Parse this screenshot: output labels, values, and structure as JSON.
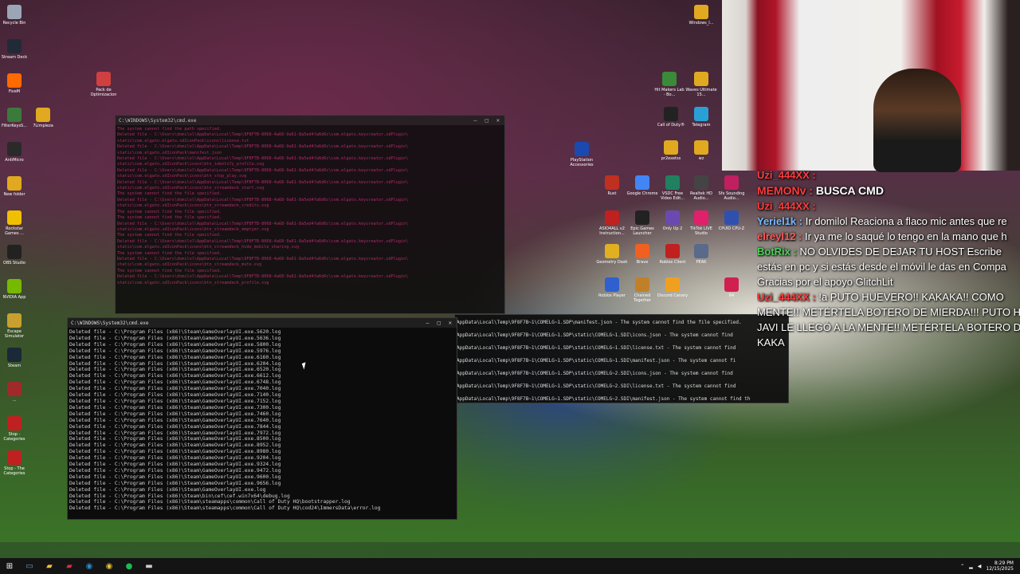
{
  "desktop": {
    "left_icons": [
      {
        "label": "Recycle Bin",
        "color": "#9aa6b5"
      },
      {
        "label": "Stream Deck",
        "color": "#222a38"
      },
      {
        "label": "FiveM",
        "color": "#ff6a00"
      },
      {
        "label": "FilterKeysS...",
        "color": "#3a7a3a"
      },
      {
        "label": "AntiMicro",
        "color": "#2a2a2a"
      },
      {
        "label": "New folder",
        "color": "#e0a920"
      },
      {
        "label": "Rockstar Games ...",
        "color": "#f0c000"
      },
      {
        "label": "OBS Studio",
        "color": "#222"
      },
      {
        "label": "NVIDIA App",
        "color": "#76b900"
      },
      {
        "label": "Escape Simulator",
        "color": "#c8a030"
      },
      {
        "label": "Steam",
        "color": "#1b2838"
      },
      {
        "label": "...",
        "color": "#a02a2a"
      },
      {
        "label": "Stop - Categories",
        "color": "#c02020"
      },
      {
        "label": "Stop - The Categories",
        "color": "#c02020"
      }
    ],
    "col2_icons": [
      {
        "label": "Pack de Optimizacion",
        "color": "#d04040"
      },
      {
        "label": "7Limpieza",
        "color": "#e0a920"
      }
    ],
    "right_icons": [
      {
        "label": "Windows_I...",
        "color": "#e0a920"
      },
      {
        "label": "Hit Makers Lab - Bo...",
        "color": "#3a8a3a"
      },
      {
        "label": "Waves Ultimate 15...",
        "color": "#e0a920"
      },
      {
        "label": "Call of Duty®",
        "color": "#222"
      },
      {
        "label": "Telegram",
        "color": "#2a9fd6"
      },
      {
        "label": "PlayStation Accessories",
        "color": "#1a4ab0"
      },
      {
        "label": "pr2exetss",
        "color": "#e0a920"
      },
      {
        "label": "wz",
        "color": "#e0a920"
      },
      {
        "label": "Rust",
        "color": "#c03020"
      },
      {
        "label": "Google Chrome",
        "color": "#4285f4"
      },
      {
        "label": "VSDC Free Video Edit...",
        "color": "#208060"
      },
      {
        "label": "Realtek HD Audio...",
        "color": "#444"
      },
      {
        "label": "Sfx Sounding Audio...",
        "color": "#c02060"
      },
      {
        "label": "ASIO4ALL v2 Instruction...",
        "color": "#c02020"
      },
      {
        "label": "Epic Games Launcher",
        "color": "#222"
      },
      {
        "label": "Only Up 2",
        "color": "#6a4ab0"
      },
      {
        "label": "TikTok LIVE Studio",
        "color": "#e0206a"
      },
      {
        "label": "CPUID CPU-Z",
        "color": "#3050b0"
      },
      {
        "label": "Geometry Dash",
        "color": "#e0b020"
      },
      {
        "label": "Brave",
        "color": "#f06020"
      },
      {
        "label": "Roblox Client",
        "color": "#c02020"
      },
      {
        "label": "PEAK",
        "color": "#5a6a8a"
      },
      {
        "label": "Roblox Player",
        "color": "#3060d0"
      },
      {
        "label": "Chained Together",
        "color": "#c0802a"
      },
      {
        "label": "Discord Canary",
        "color": "#f0a020"
      },
      {
        "label": "64",
        "color": "#d02050"
      }
    ]
  },
  "cmd_back": {
    "title": "C:\\WINDOWS\\System32\\cmd.exe",
    "lines": [
      "The system cannot find the path specified.",
      "Deleted file - C:\\Users\\domilol\\AppData\\Local\\Temp\\9F8F7B-8068-4a68-9a61-8a5ed4fa6d6c\\com.elgato.keycreator.sdPlugin\\",
      "static\\com.elgato.elgato.sdIconPack\\icons\\license.txt",
      "Deleted file - C:\\Users\\domilol\\AppData\\Local\\Temp\\9F8F7B-8068-4a68-9a61-8a5ed4fa6d6c\\com.elgato.keycreator.sdPlugin\\",
      "static\\com.elgato.sdIconPack\\manifest.json",
      "Deleted file - C:\\Users\\domilol\\AppData\\Local\\Temp\\9F8F7B-8068-4a68-9a61-8a5ed4fa6d6c\\com.elgato.keycreator.sdPlugin\\",
      "static\\com.elgato.sdIconPack\\icons\\btn_identify_profile.svg",
      "Deleted file - C:\\Users\\domilol\\AppData\\Local\\Temp\\9F8F7B-8068-4a68-9a61-8a5ed4fa6d6c\\com.elgato.keycreator.sdPlugin\\",
      "static\\com.elgato.sdIconPack\\icons\\btn_stop_play.svg",
      "Deleted file - C:\\Users\\domilol\\AppData\\Local\\Temp\\9F8F7B-8068-4a68-9a61-8a5ed4fa6d6c\\com.elgato.keycreator.sdPlugin\\",
      "static\\com.elgato.sdIconPack\\icons\\btn_streamdeck_start.svg",
      "The system cannot find the file specified.",
      "Deleted file - C:\\Users\\domilol\\AppData\\Local\\Temp\\9F8F7B-8068-4a68-9a61-8a5ed4fa6d6c\\com.elgato.keycreator.sdPlugin\\",
      "static\\com.elgato.sdIconPack\\icons\\btn_streamdeck_credits.svg",
      "The system cannot find the file specified.",
      "The system cannot find the file specified.",
      "Deleted file - C:\\Users\\domilol\\AppData\\Local\\Temp\\9F8F7B-8068-4a68-9a61-8a5ed4fa6d6c\\com.elgato.keycreator.sdPlugin\\",
      "static\\com.elgato.sdIconPack\\icons\\btn_streamdeck_emptyer.svg",
      "The system cannot find the file specified.",
      "Deleted file - C:\\Users\\domilol\\AppData\\Local\\Temp\\9F8F7B-8068-4a68-9a61-8a5ed4fa6d6c\\com.elgato.keycreator.sdPlugin\\",
      "static\\com.elgato.sdIconPack\\icons\\btn_streamdeck_hide_mobile_sharing.svg",
      "The system cannot find the file specified.",
      "Deleted file - C:\\Users\\domilol\\AppData\\Local\\Temp\\9F8F7B-8068-4a68-9a61-8a5ed4fa6d6c\\com.elgato.keycreator.sdPlugin\\",
      "static\\com.elgato.sdIconPack\\icons\\btn_streamdeck_mute.svg",
      "The system cannot find the file specified.",
      "Deleted file - C:\\Users\\domilol\\AppData\\Local\\Temp\\9F8F7B-8068-4a68-9a61-8a5ed4fa6d6c\\com.elgato.keycreator.sdPlugin\\",
      "static\\com.elgato.sdIconPack\\icons\\btn_streamdeck_profile.svg"
    ]
  },
  "cmd_main": {
    "title": "C:\\WINDOWS\\System32\\cmd.exe",
    "lines": [
      "Deleted file - C:\\Program Files (x86)\\Steam\\GameOverlayUI.exe.5620.log",
      "Deleted file - C:\\Program Files (x86)\\Steam\\GameOverlayUI.exe.5636.log",
      "Deleted file - C:\\Program Files (x86)\\Steam\\GameOverlayUI.exe.5800.log",
      "Deleted file - C:\\Program Files (x86)\\Steam\\GameOverlayUI.exe.5976.log",
      "Deleted file - C:\\Program Files (x86)\\Steam\\GameOverlayUI.exe.6160.log",
      "Deleted file - C:\\Program Files (x86)\\Steam\\GameOverlayUI.exe.6204.log",
      "Deleted file - C:\\Program Files (x86)\\Steam\\GameOverlayUI.exe.6520.log",
      "Deleted file - C:\\Program Files (x86)\\Steam\\GameOverlayUI.exe.6612.log",
      "Deleted file - C:\\Program Files (x86)\\Steam\\GameOverlayUI.exe.6748.log",
      "Deleted file - C:\\Program Files (x86)\\Steam\\GameOverlayUI.exe.7040.log",
      "Deleted file - C:\\Program Files (x86)\\Steam\\GameOverlayUI.exe.7140.log",
      "Deleted file - C:\\Program Files (x86)\\Steam\\GameOverlayUI.exe.7152.log",
      "Deleted file - C:\\Program Files (x86)\\Steam\\GameOverlayUI.exe.7300.log",
      "Deleted file - C:\\Program Files (x86)\\Steam\\GameOverlayUI.exe.7460.log",
      "Deleted file - C:\\Program Files (x86)\\Steam\\GameOverlayUI.exe.7640.log",
      "Deleted file - C:\\Program Files (x86)\\Steam\\GameOverlayUI.exe.7844.log",
      "Deleted file - C:\\Program Files (x86)\\Steam\\GameOverlayUI.exe.7972.log",
      "Deleted file - C:\\Program Files (x86)\\Steam\\GameOverlayUI.exe.8500.log",
      "Deleted file - C:\\Program Files (x86)\\Steam\\GameOverlayUI.exe.8952.log",
      "Deleted file - C:\\Program Files (x86)\\Steam\\GameOverlayUI.exe.8980.log",
      "Deleted file - C:\\Program Files (x86)\\Steam\\GameOverlayUI.exe.9204.log",
      "Deleted file - C:\\Program Files (x86)\\Steam\\GameOverlayUI.exe.9324.log",
      "Deleted file - C:\\Program Files (x86)\\Steam\\GameOverlayUI.exe.9472.log",
      "Deleted file - C:\\Program Files (x86)\\Steam\\GameOverlayUI.exe.9600.log",
      "Deleted file - C:\\Program Files (x86)\\Steam\\GameOverlayUI.exe.9656.log",
      "Deleted file - C:\\Program Files (x86)\\Steam\\GameOverlayUI.exe.log",
      "Deleted file - C:\\Program Files (x86)\\Steam\\bin\\cef\\cef.win7x64\\debug.log",
      "Deleted file - C:\\Program Files (x86)\\Steam\\steamapps\\common\\Call of Duty HQ\\bootstrapper.log",
      "Deleted file - C:\\Program Files (x86)\\Steam\\steamapps\\common\\Call of Duty HQ\\cod24\\ImmersData\\error.log"
    ]
  },
  "cmd_right": {
    "lines": [
      "AppData\\Local\\Temp\\9F8F7B~1\\COMELG~1.SDP\\manifest.json - The system cannot find the file specified.",
      "AppData\\Local\\Temp\\9F8F7B~1\\COMELG~1.SDP\\static\\COMELG~1.SDI\\icons.json - The system cannot find",
      "AppData\\Local\\Temp\\9F8F7B~1\\COMELG~1.SDP\\static\\COMELG~1.SDI\\license.txt - The system cannot find",
      "AppData\\Local\\Temp\\9F8F7B~1\\COMELG~1.SDP\\static\\COMELG~1.SDI\\manifest.json - The system cannot fi",
      "AppData\\Local\\Temp\\9F8F7B~1\\COMELG~1.SDP\\static\\COMELG~2.SDI\\icons.json - The system cannot find",
      "AppData\\Local\\Temp\\9F8F7B~1\\COMELG~1.SDP\\static\\COMELG~2.SDI\\license.txt - The system cannot find",
      "AppData\\Local\\Temp\\9F8F7B~1\\COMELG~1.SDP\\static\\COMELG~2.SDI\\manifest.json - The system cannot find th"
    ]
  },
  "chat": [
    {
      "user": "Uzi_444XX :",
      "text": "",
      "user_color": "#ff3b3b"
    },
    {
      "user": "MEMONv :",
      "text": "BUSCA CMD",
      "user_color": "#ff3b3b",
      "big": true
    },
    {
      "user": "Uzi_444XX :",
      "text": "",
      "user_color": "#ff3b3b"
    },
    {
      "user": "Yeriel1k :",
      "text": "Ir domilol Reaciona a flaco mic antes que re",
      "user_color": "#7ab8ff"
    },
    {
      "user": "elreyl12 :",
      "text": "Ir ya me lo saqué lo tengo en la mano que h",
      "user_color": "#ff5a5a"
    },
    {
      "user": "BotRix :",
      "text": "NO OLVIDES DE DEJAR TU HOST Escribe",
      "user_color": "#4cd05a"
    },
    {
      "user": "",
      "text": "estás en pc y si estás desde el móvil le das en Compa",
      "user_color": "#ffffff"
    },
    {
      "user": "",
      "text": "Gracias por el apoyo GlitchLit",
      "user_color": "#ffffff"
    },
    {
      "user": "Uzi_444XX :",
      "text": "!a PUTO HUEVERO!! KAKAKA!! COMO",
      "user_color": "#ff3b3b"
    },
    {
      "user": "",
      "text": "MENTE!! METÉRTELA BOTERO DE MIERDA!!! PUTO HU",
      "user_color": "#ffffff"
    },
    {
      "user": "",
      "text": "JAVI LE LLEGÓ A LA MENTE!! METÉRTELA BOTERO DE",
      "user_color": "#ffffff"
    },
    {
      "user": "",
      "text": "KAKA",
      "user_color": "#ffffff"
    }
  ],
  "taskbar": {
    "items": [
      {
        "name": "start-icon",
        "glyph": "⊞",
        "color": "#ffffff"
      },
      {
        "name": "search-icon",
        "glyph": "▭",
        "color": "#60a0d0"
      },
      {
        "name": "file-explorer-icon",
        "glyph": "▰",
        "color": "#f0c040"
      },
      {
        "name": "app-red-icon",
        "glyph": "▰",
        "color": "#d03040"
      },
      {
        "name": "edge-icon",
        "glyph": "◉",
        "color": "#2a8ad0"
      },
      {
        "name": "chrome-icon",
        "glyph": "◉",
        "color": "#e0c040"
      },
      {
        "name": "spotify-icon",
        "glyph": "●",
        "color": "#1db954"
      },
      {
        "name": "terminal-icon",
        "glyph": "▬",
        "color": "#cccccc"
      }
    ],
    "time": "8:29 PM",
    "date": "12/15/2025"
  }
}
